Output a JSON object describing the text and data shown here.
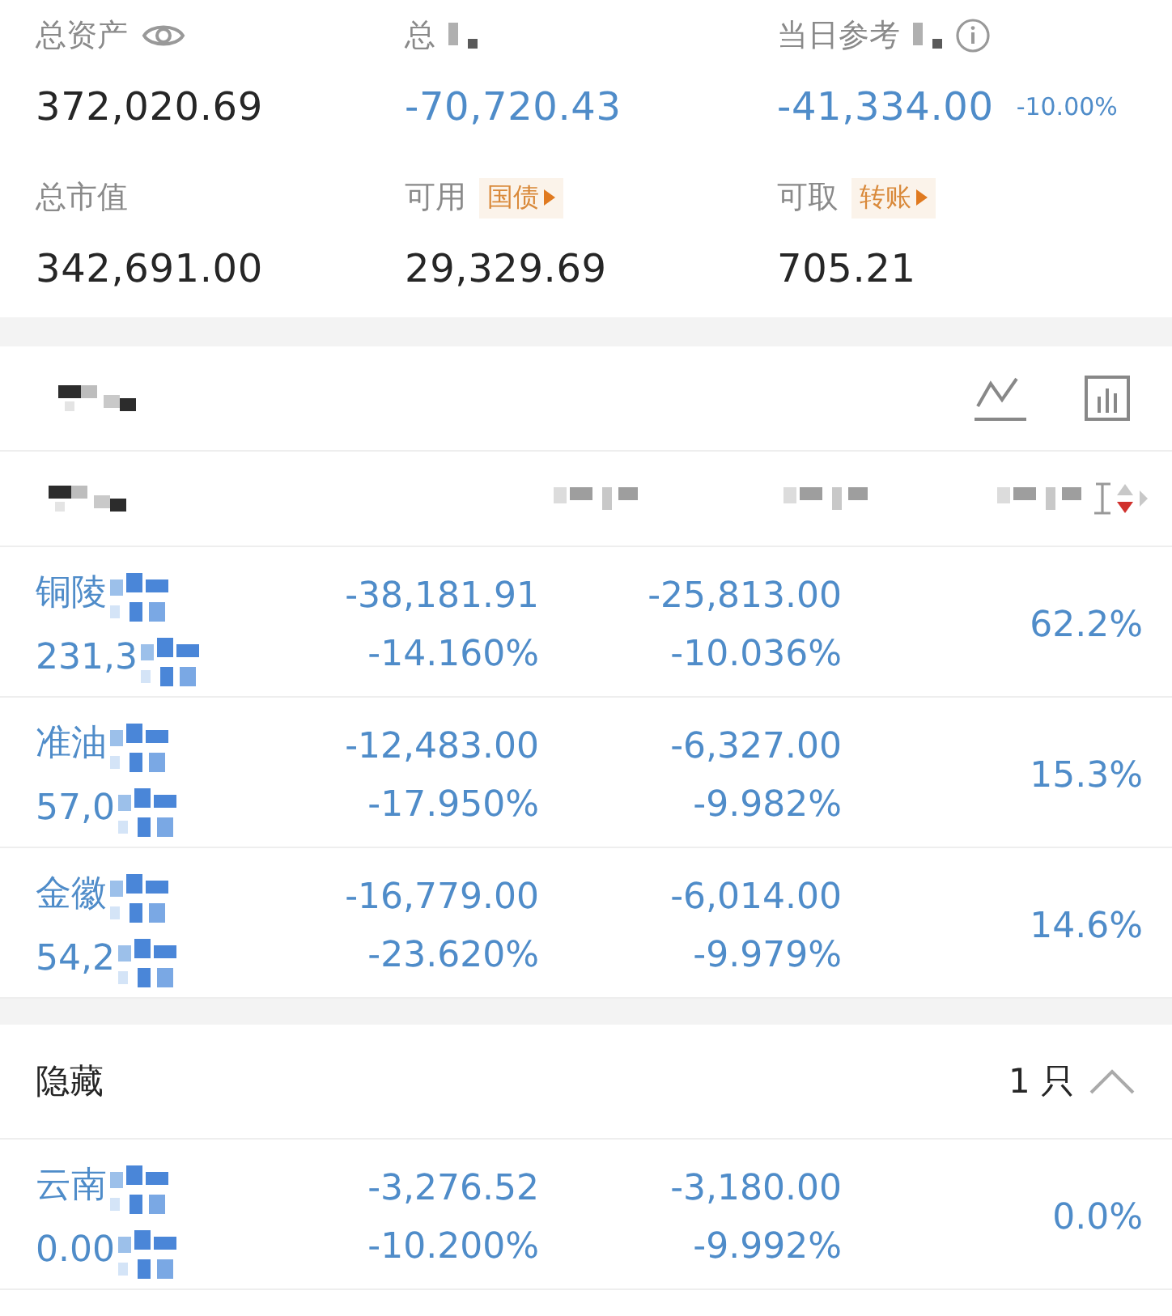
{
  "summary": [
    {
      "label": "总资产",
      "masked": false,
      "value": "372,020.69",
      "negative": false
    },
    {
      "label": "总",
      "masked": true,
      "value": "-70,720.43",
      "negative": true
    },
    {
      "label": "当日参考",
      "masked": true,
      "value": "-41,334.00",
      "negative": true,
      "change": "-10.00%"
    },
    {
      "label": "总市值",
      "masked": false,
      "value": "342,691.00",
      "negative": false
    },
    {
      "label": "可用",
      "masked": false,
      "tag": "国债",
      "value": "29,329.69",
      "negative": false
    },
    {
      "label": "可取",
      "masked": false,
      "tag": "转账",
      "value": "705.21",
      "negative": false
    }
  ],
  "column_header": {
    "sort_descending": true
  },
  "holdings": [
    {
      "name": "铜陵",
      "value": "231,3",
      "pnl": "-38,181.91",
      "pnl_pct": "-14.160%",
      "day": "-25,813.00",
      "day_pct": "-10.036%",
      "share": "62.2%"
    },
    {
      "name": "准油",
      "value": "57,0",
      "pnl": "-12,483.00",
      "pnl_pct": "-17.950%",
      "day": "-6,327.00",
      "day_pct": "-9.982%",
      "share": "15.3%"
    },
    {
      "name": "金徽",
      "value": "54,2",
      "pnl": "-16,779.00",
      "pnl_pct": "-23.620%",
      "day": "-6,014.00",
      "day_pct": "-9.979%",
      "share": "14.6%"
    }
  ],
  "hidden": {
    "label": "隐藏",
    "count": "1 只",
    "expanded": true,
    "rows": [
      {
        "name": "云南",
        "value": "0.00",
        "pnl": "-3,276.52",
        "pnl_pct": "-10.200%",
        "day": "-3,180.00",
        "day_pct": "-9.992%",
        "share": "0.0%"
      }
    ]
  }
}
